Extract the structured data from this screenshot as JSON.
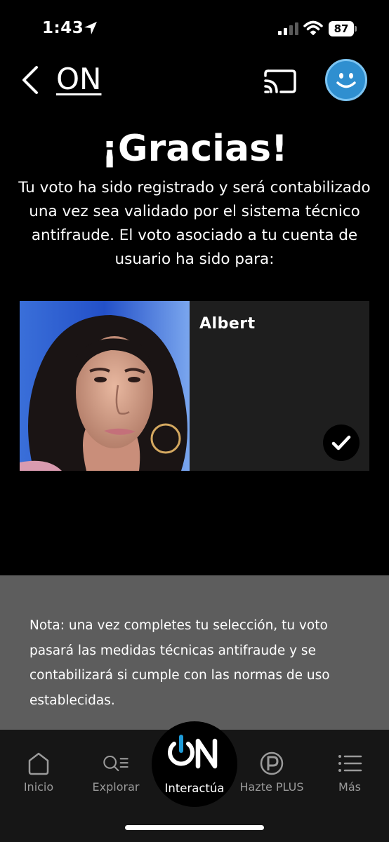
{
  "status_bar": {
    "time": "1:43",
    "battery": "87"
  },
  "header": {
    "title": "ON"
  },
  "thanks": {
    "title": "¡Gracias!",
    "message": "Tu voto ha sido registrado y será contabilizado una vez sea validado por el sistema técnico antifraude. El voto asociado a tu cuenta de usuario ha sido para:"
  },
  "candidate": {
    "name": "Albert",
    "selected": true
  },
  "note": {
    "text": "Nota: una vez completes tu selección, tu voto pasará las medidas técnicas antifraude y se contabilizará si cumple con las normas de uso establecidas."
  },
  "tabbar": {
    "items": [
      {
        "label": "Inicio",
        "icon": "home-icon"
      },
      {
        "label": "Explorar",
        "icon": "search-list-icon"
      },
      {
        "label": "Interactúa",
        "icon": "on-power-icon",
        "active": true
      },
      {
        "label": "Hazte PLUS",
        "icon": "plus-p-icon"
      },
      {
        "label": "Más",
        "icon": "menu-list-icon"
      }
    ]
  },
  "colors": {
    "background": "#000000",
    "card": "#1e1e1e",
    "note_bg": "#5d5d5d",
    "tabbar_bg": "#161616",
    "avatar_blue": "#2f8fd0",
    "accent_blue": "#1e9bd8"
  }
}
